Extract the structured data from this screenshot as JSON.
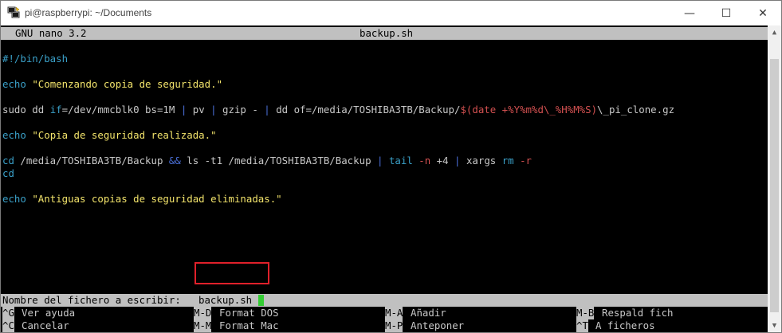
{
  "window": {
    "title": "pi@raspberrypi: ~/Documents",
    "minimize_glyph": "—",
    "maximize_glyph": "☐",
    "close_glyph": "✕"
  },
  "nano": {
    "version": "GNU nano 3.2",
    "filename": "backup.sh"
  },
  "code": {
    "shebang": "#!/bin/bash",
    "echo1_cmd": "echo",
    "echo1_str": "\"Comenzando copia de seguridad.\"",
    "dd_a": "sudo dd ",
    "dd_if": "if",
    "dd_b": "=/dev/mmcblk0 bs=1M ",
    "pipe": "|",
    "dd_c": " pv ",
    "dd_d": " gzip - ",
    "dd_e": " dd of=/media/TOSHIBA3TB/Backup/",
    "dd_f": "$(date +%Y%m%d\\_%H%M%S)",
    "dd_g": "\\_pi_clone.gz",
    "echo2_cmd": "echo",
    "echo2_str": "\"Copia de seguridad realizada.\"",
    "cd_cmd": "cd",
    "cd_a": " /media/TOSHIBA3TB/Backup ",
    "and": "&&",
    "cd_b": " ls -t1 /media/TOSHIBA3TB/Backup ",
    "tail": "tail",
    "n_flag": "-n",
    "cd_c": " +4 ",
    "cd_d": " xargs ",
    "rm": "rm",
    "r_flag": "-r",
    "cd2": "cd",
    "echo3_cmd": "echo",
    "echo3_str": "\"Antiguas copias de seguridad eliminadas.\""
  },
  "prompt": {
    "label": "Nombre del fichero a escribir:",
    "value": "backup.sh"
  },
  "help": {
    "row1": [
      {
        "key": "^G",
        "label": "Ver ayuda"
      },
      {
        "key": "M-D",
        "label": "Format DOS"
      },
      {
        "key": "M-A",
        "label": "Añadir"
      },
      {
        "key": "M-B",
        "label": "Respald fich"
      }
    ],
    "row2": [
      {
        "key": "^C",
        "label": "Cancelar"
      },
      {
        "key": "M-M",
        "label": "Format Mac"
      },
      {
        "key": "M-P",
        "label": "Anteponer"
      },
      {
        "key": "^T",
        "label": "A ficheros"
      }
    ]
  },
  "colors": {
    "keyword": "#3aa0c8",
    "string": "#f2e36b",
    "operator": "#4a6fd8",
    "flag": "#d25050",
    "highlight_box": "#e0202a",
    "cursor": "#33cc33"
  },
  "icons": {
    "app": "putty-icon",
    "scroll_up": "arrow-up-icon",
    "scroll_down": "arrow-down-icon"
  }
}
